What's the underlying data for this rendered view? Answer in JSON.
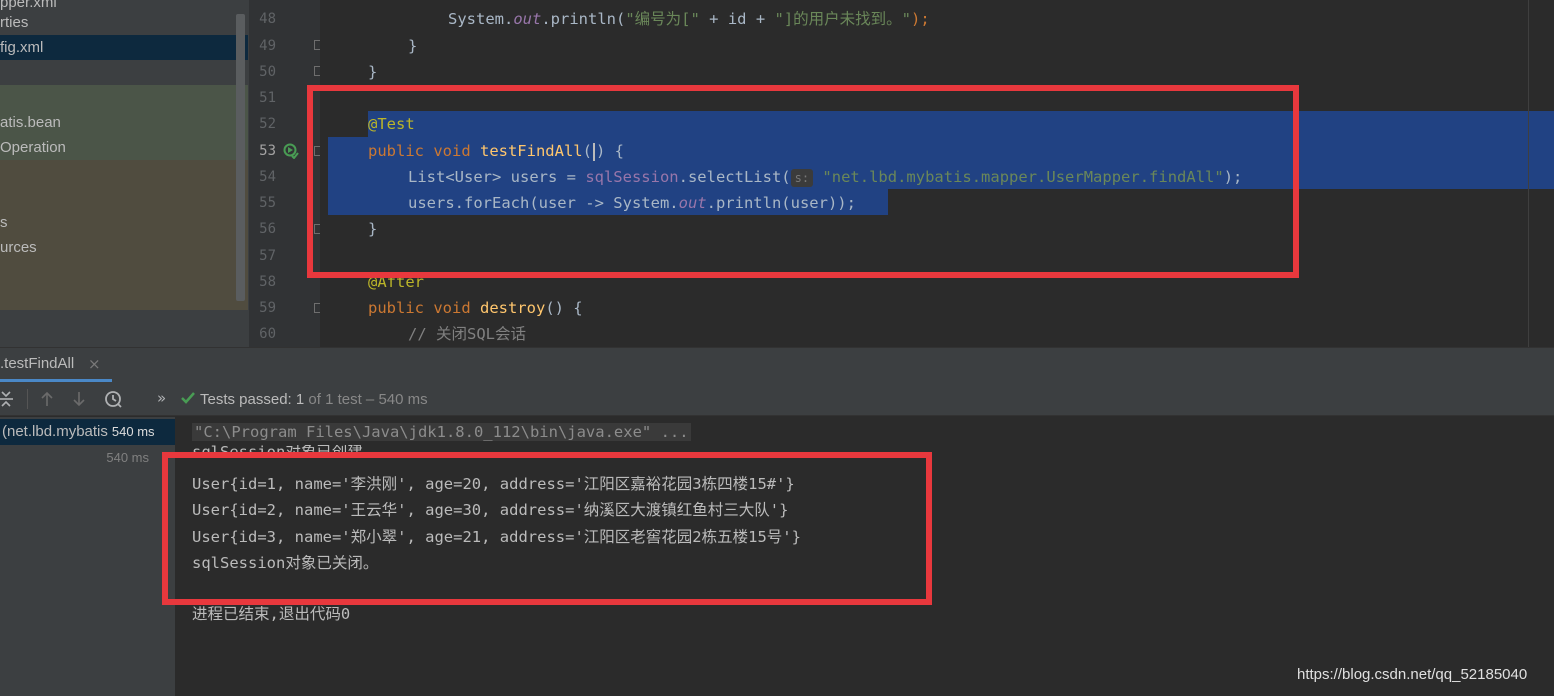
{
  "sidebar": {
    "items": [
      {
        "label": "pper.xml"
      },
      {
        "label": "rties"
      },
      {
        "label": "fig.xml"
      },
      {
        "label": "atis.bean"
      },
      {
        "label": "Operation"
      },
      {
        "label": "s"
      },
      {
        "label": "urces"
      }
    ]
  },
  "editor": {
    "line_numbers": [
      "48",
      "49",
      "50",
      "51",
      "52",
      "53",
      "54",
      "55",
      "56",
      "57",
      "58",
      "59",
      "60"
    ],
    "lines": {
      "l48_pre": "System.",
      "l48_field": "out",
      "l48_mid": ".println(",
      "l48_str1": "\"编号为[\"",
      "l48_op1": " + id + ",
      "l48_str2": "\"]的用户未找到。\"",
      "l48_end": ");",
      "l49": "}",
      "l50": "}",
      "l52_ann": "@Test",
      "l53_kw": "public void ",
      "l53_fn": "testFindAll",
      "l53_p1": "(",
      "l53_p2": ") {",
      "l54_pre": "List<User> users = ",
      "l54_field": "sqlSession",
      "l54_mid": ".selectList(",
      "l54_hint": "s:",
      "l54_str": "\"net.lbd.mybatis.mapper.UserMapper.findAll\"",
      "l54_end": ");",
      "l55_pre": "users.forEach(user -> System.",
      "l55_field": "out",
      "l55_end": ".println(user));",
      "l56": "}",
      "l58_ann": "@After",
      "l59_kw": "public void ",
      "l59_fn": "destroy",
      "l59_end": "() {",
      "l60_cmt": "// 关闭SQL会话"
    }
  },
  "run_panel": {
    "tab_label": ".testFindAll",
    "tab_close": "×",
    "status_bold": "Tests passed: ",
    "status_count": "1",
    "status_rest": " of 1 test – 540 ms",
    "tree": {
      "row1_label": "(net.lbd.mybatis",
      "row1_time": "540 ms",
      "row2_time": "540 ms"
    },
    "console": [
      "\"C:\\Program Files\\Java\\jdk1.8.0_112\\bin\\java.exe\" ...",
      "sqlSession对象已创建。",
      "User{id=1, name='李洪刚', age=20, address='江阳区嘉裕花园3栋四楼15#'}",
      "User{id=2, name='王云华', age=30, address='纳溪区大渡镇红鱼村三大队'}",
      "User{id=3, name='郑小翠', age=21, address='江阳区老窖花园2栋五楼15号'}",
      "sqlSession对象已关闭。",
      "",
      "进程已结束,退出代码0"
    ]
  },
  "watermark": "https://blog.csdn.net/qq_52185040",
  "colors": {
    "selection": "#214283",
    "highlight_box": "#e8383d",
    "passed_check": "#499c54"
  },
  "icons": [
    "run-test-passed-icon",
    "fold-marker-icon",
    "collapse-all-icon",
    "up-arrow-icon",
    "down-arrow-icon",
    "history-icon",
    "chevron-double-right-icon",
    "check-icon",
    "close-icon"
  ]
}
